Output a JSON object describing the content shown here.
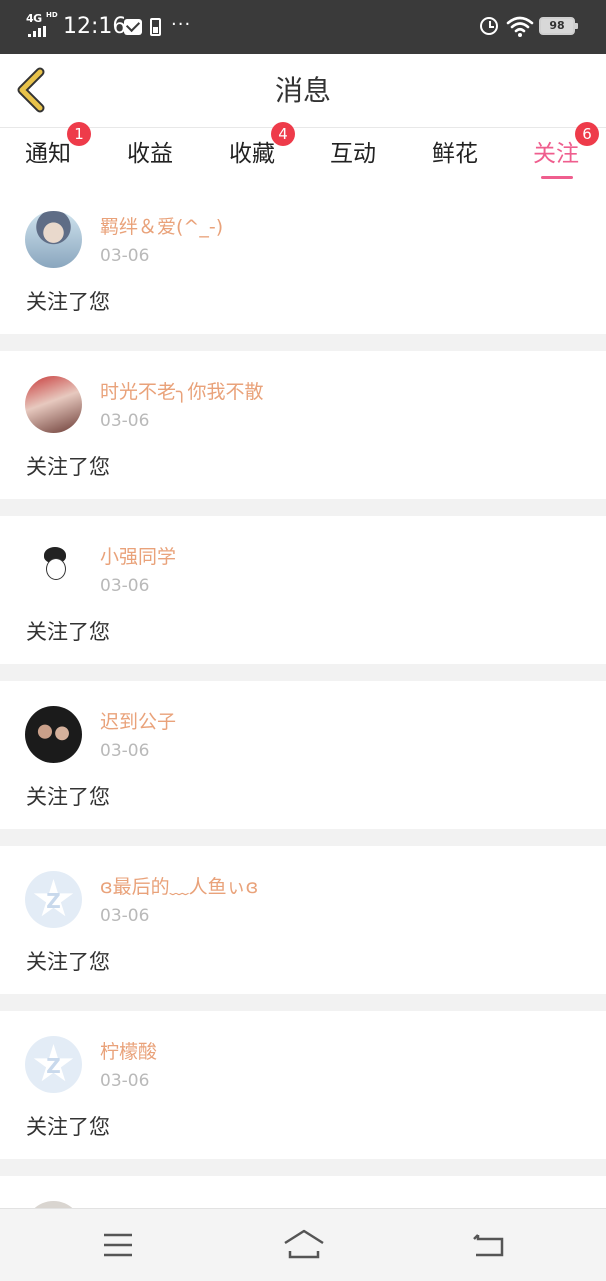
{
  "status_bar": {
    "network": "4G",
    "network_sub": "HD",
    "time": "12:16",
    "more": "···",
    "battery": "98"
  },
  "header": {
    "title": "消息"
  },
  "tabs": [
    {
      "label": "通知",
      "badge": "1",
      "active": false
    },
    {
      "label": "收益",
      "badge": "",
      "active": false
    },
    {
      "label": "收藏",
      "badge": "4",
      "active": false
    },
    {
      "label": "互动",
      "badge": "",
      "active": false
    },
    {
      "label": "鲜花",
      "badge": "",
      "active": false
    },
    {
      "label": "关注",
      "badge": "6",
      "active": true
    }
  ],
  "messages": [
    {
      "username": "羁绊＆爱(^_-)",
      "date": "03-06",
      "text": "关注了您",
      "avatar": "photo-avatar"
    },
    {
      "username": "时光不老╮你我不散",
      "date": "03-06",
      "text": "关注了您",
      "avatar": "photo-avatar"
    },
    {
      "username": "小强同学",
      "date": "03-06",
      "text": "关注了您",
      "avatar": "cartoon-avatar"
    },
    {
      "username": "迟到公子",
      "date": "03-06",
      "text": "关注了您",
      "avatar": "photo-avatar"
    },
    {
      "username": "ɞ最后的﹏人鱼ぃɞ",
      "date": "03-06",
      "text": "关注了您",
      "avatar": "default-avatar"
    },
    {
      "username": "柠檬酸",
      "date": "03-06",
      "text": "关注了您",
      "avatar": "default-avatar"
    }
  ],
  "nav_bar": {
    "icons": [
      "menu-icon",
      "home-icon",
      "back-icon"
    ]
  },
  "colors": {
    "accent": "#ef5e8e",
    "username": "#e9a27a",
    "badge": "#ee3b4a",
    "back_arrow": "#e8c24a"
  }
}
